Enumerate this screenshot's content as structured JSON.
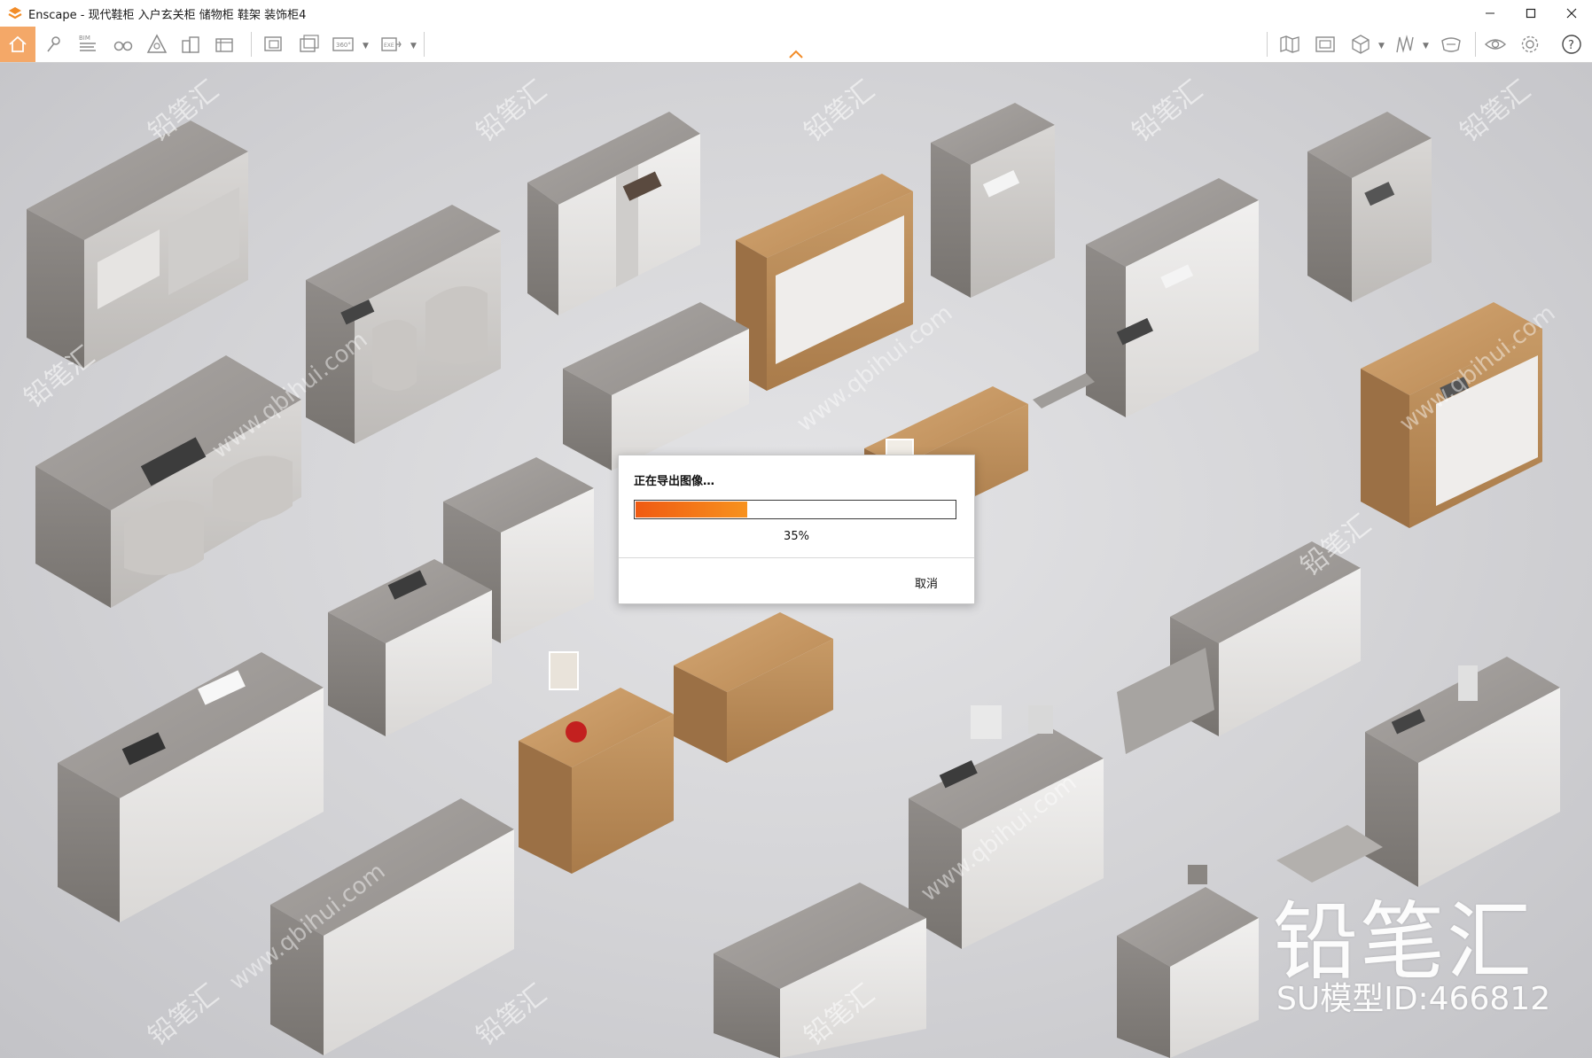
{
  "window": {
    "app_name": "Enscape",
    "title": "Enscape - 现代鞋柜 入户玄关柜 储物柜 鞋架 装饰柜4",
    "controls": [
      "minimize-icon",
      "maximize-icon",
      "close-icon"
    ]
  },
  "toolbar": {
    "left_tools": [
      {
        "name": "home-icon",
        "active": true
      },
      {
        "name": "location-pin-icon"
      },
      {
        "name": "bim-icon",
        "label": "BIM"
      },
      {
        "name": "binoculars-icon"
      },
      {
        "name": "atmosphere-icon"
      },
      {
        "name": "buildings-icon"
      },
      {
        "name": "asset-library-icon"
      },
      {
        "name": "screenshot-icon"
      },
      {
        "name": "batch-render-icon"
      },
      {
        "name": "panorama-360-icon",
        "label": "360°"
      },
      {
        "name": "export-exe-icon",
        "label": "EXE"
      }
    ],
    "right_tools": [
      {
        "name": "map-icon"
      },
      {
        "name": "views-icon"
      },
      {
        "name": "cube-icon"
      },
      {
        "name": "material-icon"
      },
      {
        "name": "collaborate-icon"
      },
      {
        "name": "visibility-eye-icon"
      },
      {
        "name": "settings-gear-icon"
      },
      {
        "name": "help-icon"
      }
    ],
    "accent": "#f4a868"
  },
  "dialog": {
    "title": "正在导出图像…",
    "progress_percent": 35,
    "progress_label": "35%",
    "cancel_label": "取消",
    "progress_colors": [
      "#f05a12",
      "#f7921e"
    ]
  },
  "watermark": {
    "brand": "铅笔汇",
    "model_id": "SU模型ID:466812",
    "tile_text": "铅笔汇",
    "url_text": "www.qbihui.com"
  }
}
